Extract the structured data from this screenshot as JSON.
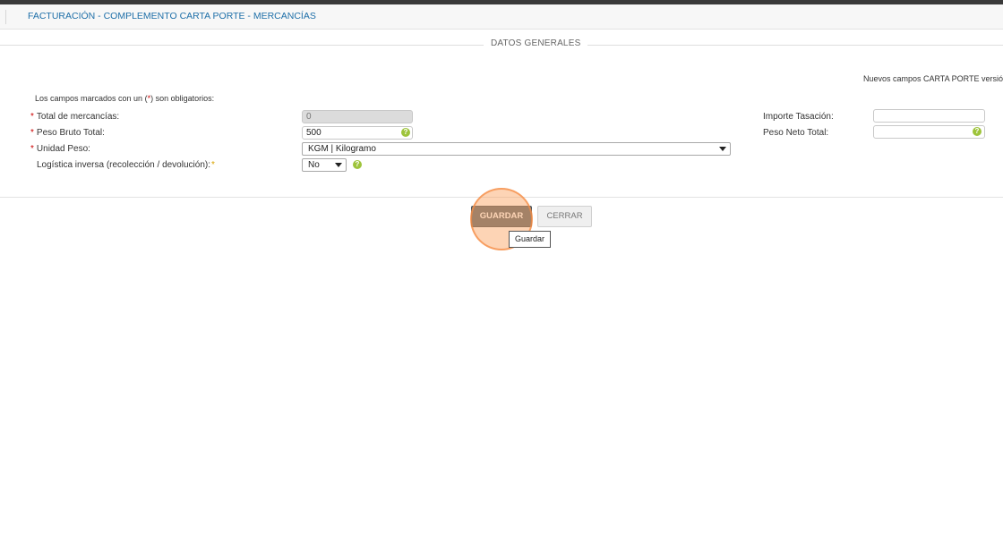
{
  "header": {
    "title": "FACTURACIÓN - COMPLEMENTO CARTA PORTE - MERCANCÍAS"
  },
  "section": {
    "legend": "DATOS GENERALES"
  },
  "note": "Nuevos campos CARTA PORTE versió",
  "required_legend": {
    "prefix": "Los campos marcados con un (",
    "star": "*",
    "suffix": ") son obligatorios:"
  },
  "fields": {
    "total_mercancias": {
      "label": "Total de mercancías:",
      "value": "0",
      "required": "*"
    },
    "peso_bruto_total": {
      "label": "Peso Bruto Total:",
      "value": "500",
      "required": "*"
    },
    "unidad_peso": {
      "label": "Unidad Peso:",
      "value": "KGM | Kilogramo",
      "required": "*"
    },
    "logistica_inversa": {
      "label": "Logística inversa (recolección / devolución):",
      "value": "No",
      "required": "*"
    },
    "importe_tasacion": {
      "label": "Importe Tasación:",
      "value": ""
    },
    "peso_neto_total": {
      "label": "Peso Neto Total:",
      "value": ""
    }
  },
  "help_glyph": "?",
  "buttons": {
    "save": "GUARDAR",
    "close": "CERRAR"
  },
  "tooltip": "Guardar",
  "colors": {
    "title": "#1e6fa8",
    "required_star": "#c00000",
    "help_icon": "#9ec43b",
    "save_button": "#5d6b72",
    "highlight": "#f5a05a"
  }
}
